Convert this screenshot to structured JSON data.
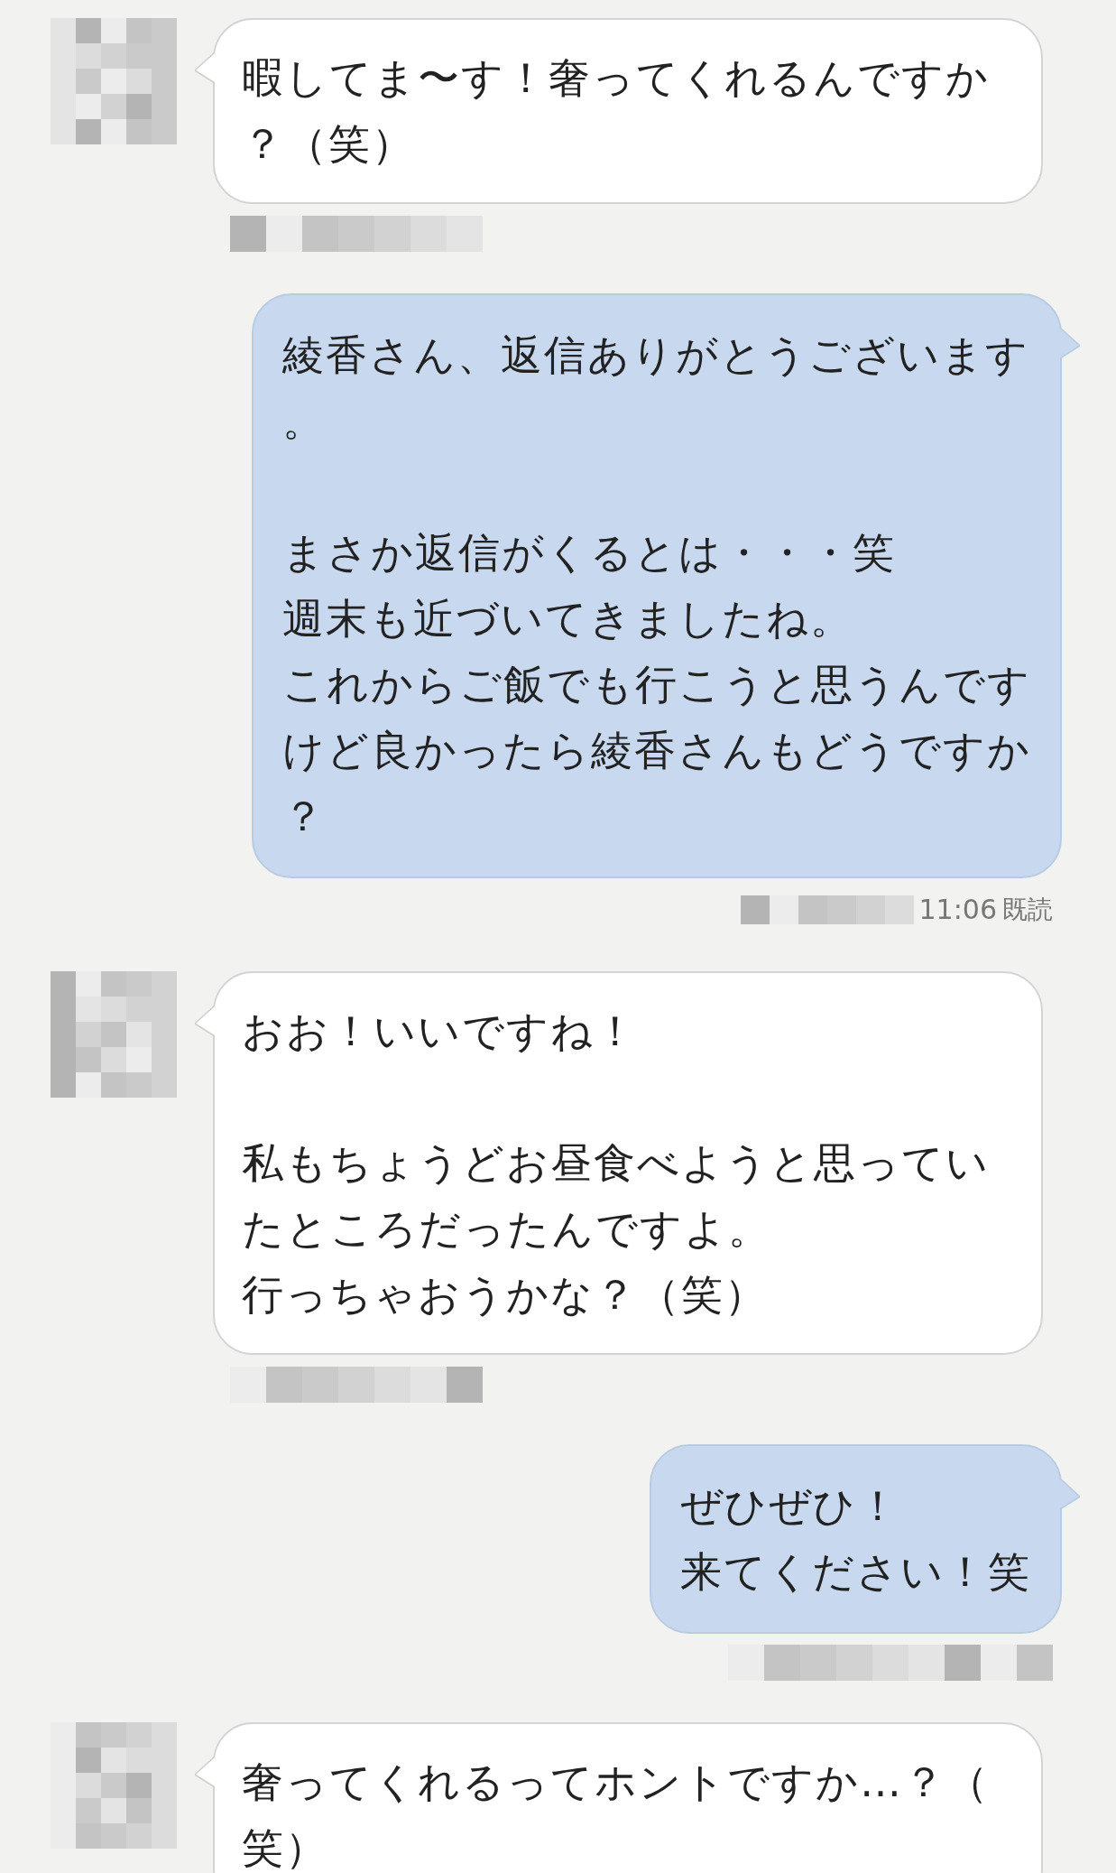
{
  "messages": [
    {
      "kind": "incoming",
      "paragraphs": [
        [
          "暇してま〜す！奢ってくれるんですか",
          "？（笑）"
        ]
      ],
      "redacted_meta": true
    },
    {
      "kind": "outgoing",
      "paragraphs": [
        [
          "綾香さん、返信ありがとうございます",
          "。"
        ],
        [
          "まさか返信がくるとは・・・笑",
          "週末も近づいてきましたね。",
          "これからご飯でも行こうと思うんです",
          "けど良かったら綾香さんもどうですか",
          "？"
        ]
      ],
      "time": "11:06",
      "read_status": "既読",
      "redacted_meta": true
    },
    {
      "kind": "incoming",
      "paragraphs": [
        [
          "おお！いいですね！"
        ],
        [
          "私もちょうどお昼食べようと思ってい",
          "たところだったんですよ。",
          "行っちゃおうかな？（笑）"
        ]
      ],
      "redacted_meta": true
    },
    {
      "kind": "outgoing",
      "paragraphs": [
        [
          "ぜひぜひ！",
          "来てください！笑"
        ]
      ],
      "redacted_meta": true
    },
    {
      "kind": "incoming",
      "paragraphs": [
        [
          "奢ってくれるってホントですか…？（",
          "笑）"
        ]
      ],
      "redacted_meta": false
    }
  ]
}
